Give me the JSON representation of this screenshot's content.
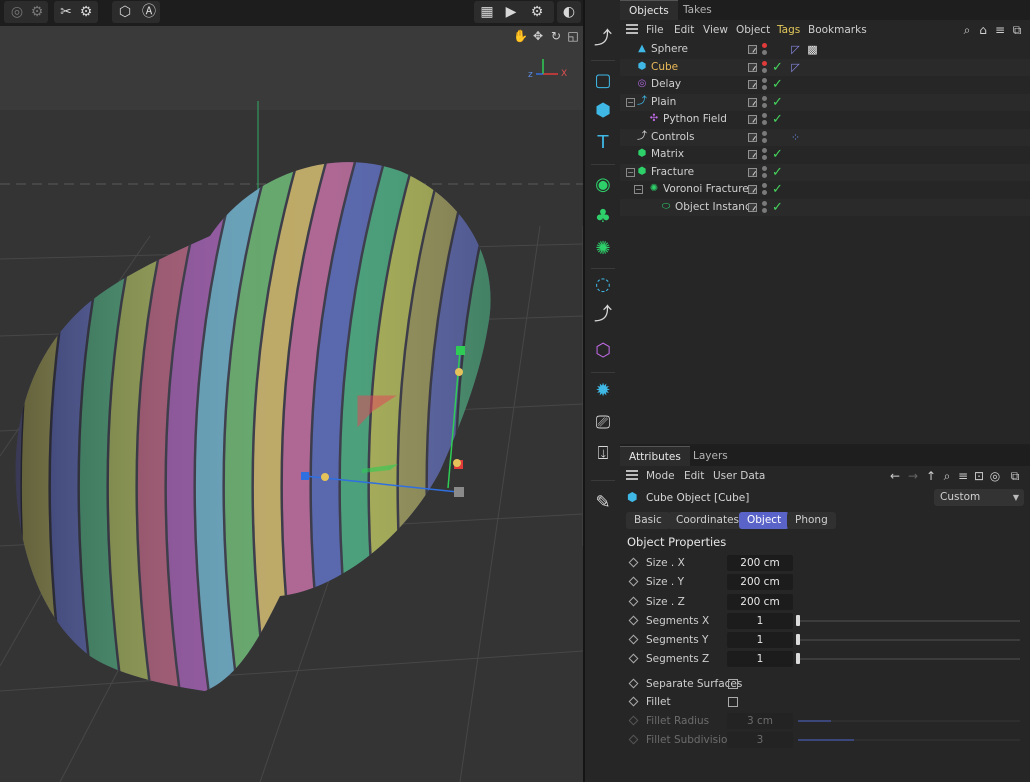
{
  "objects_panel": {
    "tabs": [
      {
        "label": "Objects"
      },
      {
        "label": "Takes"
      }
    ],
    "menu": [
      {
        "label": "File"
      },
      {
        "label": "Edit"
      },
      {
        "label": "View"
      },
      {
        "label": "Object"
      },
      {
        "label": "Tags"
      },
      {
        "label": "Bookmarks"
      }
    ],
    "items": [
      {
        "name": "Sphere",
        "icon": "sphere-icon",
        "icon_color": "#3fb8e6",
        "active_checkmark": false,
        "selected": false
      },
      {
        "name": "Cube",
        "icon": "cube-icon",
        "icon_color": "#3fb8e6",
        "active_checkmark": true,
        "selected": true
      },
      {
        "name": "Delay",
        "icon": "delay-effector-icon",
        "icon_color": "#b36be6",
        "active_checkmark": true,
        "selected": false
      },
      {
        "name": "Plain",
        "icon": "plain-effector-icon",
        "icon_color": "#3fb8e6",
        "active_checkmark": true,
        "selected": false
      },
      {
        "name": "Python Field",
        "icon": "python-field-icon",
        "icon_color": "#c16be6",
        "active_checkmark": true,
        "selected": false
      },
      {
        "name": "Controls",
        "icon": "null-object-icon",
        "icon_color": "#d8d8d8",
        "active_checkmark": false,
        "selected": false
      },
      {
        "name": "Matrix",
        "icon": "matrix-icon",
        "icon_color": "#2ed06a",
        "active_checkmark": true,
        "selected": false
      },
      {
        "name": "Fracture",
        "icon": "fracture-icon",
        "icon_color": "#2ed06a",
        "active_checkmark": true,
        "selected": false
      },
      {
        "name": "Voronoi Fracture",
        "icon": "voronoi-fracture-icon",
        "icon_color": "#2ed06a",
        "active_checkmark": true,
        "selected": false
      },
      {
        "name": "Object Instance",
        "icon": "instance-icon",
        "icon_color": "#2ed06a",
        "active_checkmark": true,
        "selected": false
      }
    ]
  },
  "attributes_panel": {
    "tabs": [
      {
        "label": "Attributes"
      },
      {
        "label": "Layers"
      }
    ],
    "menu": [
      {
        "label": "Mode"
      },
      {
        "label": "Edit"
      },
      {
        "label": "User Data"
      }
    ],
    "object_title": "Cube Object [Cube]",
    "preset": "Custom",
    "sections": [
      {
        "label": "Basic"
      },
      {
        "label": "Coordinates"
      },
      {
        "label": "Object",
        "active": true
      },
      {
        "label": "Phong"
      }
    ],
    "group_title": "Object Properties",
    "properties": [
      {
        "label": "Size . X",
        "value": "200 cm"
      },
      {
        "label": "Size . Y",
        "value": "200 cm"
      },
      {
        "label": "Size . Z",
        "value": "200 cm"
      },
      {
        "label": "Segments X",
        "value": "1",
        "slider_fraction": 0.0
      },
      {
        "label": "Segments Y",
        "value": "1",
        "slider_fraction": 0.0
      },
      {
        "label": "Segments Z",
        "value": "1",
        "slider_fraction": 0.0
      },
      {
        "label": "Separate Surfaces",
        "checked": false
      },
      {
        "label": "Fillet",
        "checked": false
      },
      {
        "label": "Fillet Radius",
        "value": "3 cm",
        "enabled": false,
        "slider_fraction": 0.15
      },
      {
        "label": "Fillet Subdivision",
        "value": "3",
        "enabled": false,
        "slider_fraction": 0.25
      }
    ]
  },
  "viewport": {
    "axis_labels": {
      "z": "z",
      "x": "X"
    }
  },
  "colors": {
    "accent": "#5a63c8",
    "selected_text": "#eab957",
    "check_green": "#46d65e",
    "stripe_colors": [
      "#8d8a4f",
      "#4f5aa0",
      "#3f8f6a",
      "#8c9a4a",
      "#a04f6c",
      "#8a4a9a",
      "#5a9ab4",
      "#58a060",
      "#b8a25a",
      "#a85a8a",
      "#4a5aa8",
      "#3a9a70",
      "#a0a84a"
    ]
  }
}
